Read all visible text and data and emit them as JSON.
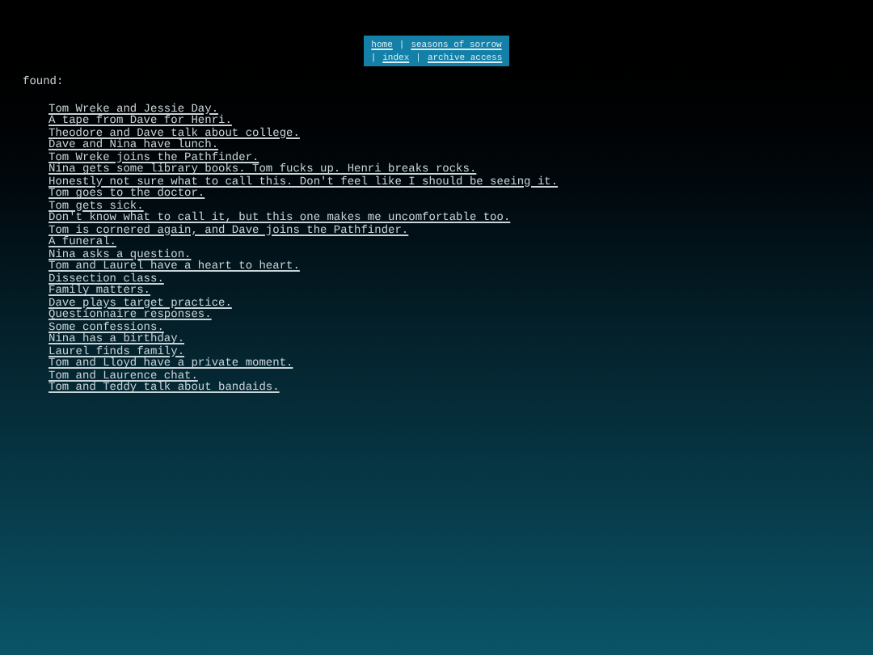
{
  "nav": {
    "rows": [
      [
        {
          "kind": "link",
          "text": "home"
        },
        {
          "kind": "separator",
          "text": "|"
        },
        {
          "kind": "link",
          "text": "seasons of sorrow"
        }
      ],
      [
        {
          "kind": "separator",
          "text": "|"
        },
        {
          "kind": "link",
          "text": "index"
        },
        {
          "kind": "separator",
          "text": "|"
        },
        {
          "kind": "link",
          "text": "archive access"
        }
      ]
    ]
  },
  "heading": "found:",
  "links": [
    "Tom Wreke and Jessie Day.",
    "A tape from Dave for Henri.",
    "Theodore and Dave talk about college.",
    "Dave and Nina have lunch.",
    "Tom Wreke joins the Pathfinder.",
    "Nina gets some library books. Tom fucks up. Henri breaks rocks.",
    "Honestly not sure what to call this. Don't feel like I should be seeing it.",
    "Tom goes to the doctor.",
    "Tom gets sick.",
    "Don't know what to call it, but this one makes me uncomfortable too.",
    "Tom is cornered again, and Dave joins the Pathfinder.",
    "A funeral.",
    "Nina asks a question.",
    "Tom and Laurel have a heart to heart.",
    "Dissection class.",
    "Family matters.",
    "Dave plays target practice.",
    "Questionnaire responses.",
    "Some confessions.",
    "Nina has a birthday.",
    "Laurel finds family.",
    "Tom and Lloyd have a private moment.",
    "Tom and Laurence chat.",
    "Tom and Teddy talk about bandaids."
  ]
}
